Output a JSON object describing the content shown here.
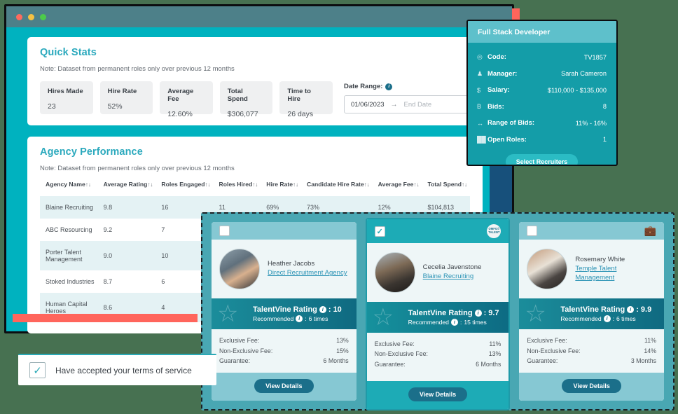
{
  "window": {
    "traffic_lights": [
      "close",
      "minimize",
      "maximize"
    ]
  },
  "quick_stats": {
    "title": "Quick Stats",
    "note": "Note: Dataset from permanent roles only over previous 12 months",
    "cards": [
      {
        "label": "Hires Made",
        "value": "23"
      },
      {
        "label": "Hire Rate",
        "value": "52%"
      },
      {
        "label": "Average Fee",
        "value": "12.60%"
      },
      {
        "label": "Total Spend",
        "value": "$306,077"
      },
      {
        "label": "Time to Hire",
        "value": "26 days"
      }
    ],
    "date_range": {
      "label": "Date Range:",
      "info_icon": "info-icon",
      "start": "01/06/2023",
      "arrow": "→",
      "end_placeholder": "End Date"
    }
  },
  "agency_performance": {
    "title": "Agency Performance",
    "note": "Note: Dataset from permanent roles only over previous 12 months",
    "columns": [
      "Agency Name",
      "Average Rating",
      "Roles Engaged",
      "Roles Hired",
      "Hire Rate",
      "Candidate Hire Rate",
      "Average Fee",
      "Total Spend"
    ],
    "sort_glyph": "↑↓",
    "rows": [
      {
        "agency": "Blaine Recruiting",
        "rating": "9.8",
        "engaged": "16",
        "hired": "11",
        "hire_rate": "69%",
        "candidate_hire_rate": "73%",
        "average_fee": "12%",
        "total_spend": "$104,813"
      },
      {
        "agency": "ABC Resourcing",
        "rating": "9.2",
        "engaged": "7",
        "hired": "",
        "hire_rate": "",
        "candidate_hire_rate": "",
        "average_fee": "",
        "total_spend": ""
      },
      {
        "agency": "Porter Talent Management",
        "rating": "9.0",
        "engaged": "10",
        "hired": "",
        "hire_rate": "",
        "candidate_hire_rate": "",
        "average_fee": "",
        "total_spend": ""
      },
      {
        "agency": "Stoked Industries",
        "rating": "8.7",
        "engaged": "6",
        "hired": "",
        "hire_rate": "",
        "candidate_hire_rate": "",
        "average_fee": "",
        "total_spend": ""
      },
      {
        "agency": "Human Capital Heroes",
        "rating": "8.6",
        "engaged": "4",
        "hired": "",
        "hire_rate": "",
        "candidate_hire_rate": "",
        "average_fee": "",
        "total_spend": ""
      }
    ]
  },
  "job_card": {
    "title": "Full Stack Developer",
    "rows": [
      {
        "icon": "target-icon",
        "glyph": "◎",
        "key": "Code:",
        "value": "TV1857"
      },
      {
        "icon": "person-icon",
        "glyph": "♟",
        "key": "Manager:",
        "value": "Sarah Cameron"
      },
      {
        "icon": "dollar-icon",
        "glyph": "$",
        "key": "Salary:",
        "value": "$110,000 - $135,000"
      },
      {
        "icon": "bid-icon",
        "glyph": "B",
        "key": "Bids:",
        "value": "8"
      },
      {
        "icon": "range-icon",
        "glyph": "↔",
        "key": "Range of Bids:",
        "value": "11% - 16%"
      },
      {
        "icon": "roles-icon",
        "glyph": "██",
        "key": "Open Roles:",
        "value": "1"
      }
    ],
    "button_label": "Select Recruiters"
  },
  "recruiters": {
    "fee_labels": {
      "exclusive": "Exclusive Fee:",
      "non_exclusive": "Non-Exclusive Fee:",
      "guarantee": "Guarantee:"
    },
    "rating_label": "TalentVine Rating",
    "recommended_label": "Recommended",
    "view_details_label": "View Details",
    "cards": [
      {
        "selected": false,
        "checkbox_glyph": "",
        "header_icon": "none",
        "avatar": "recruiter-avatar",
        "name": "Heather Jacobs",
        "agency": "Direct Recruitment Agency",
        "rating": "10",
        "recommended": "6 times",
        "exclusive_fee": "13%",
        "non_exclusive_fee": "15%",
        "guarantee": "6 Months"
      },
      {
        "selected": true,
        "checkbox_glyph": "✓",
        "header_icon": "award-badge-icon",
        "badge_text": "OMFG© TALENT",
        "avatar": "recruiter-avatar",
        "name": "Cecelia Javenstone",
        "agency": "Blaine Recruiting",
        "rating": "9.7",
        "recommended": "15 times",
        "exclusive_fee": "11%",
        "non_exclusive_fee": "13%",
        "guarantee": "6 Months"
      },
      {
        "selected": false,
        "checkbox_glyph": "",
        "header_icon": "briefcase-icon",
        "avatar": "recruiter-avatar",
        "name": "Rosemary White",
        "agency": "Temple Talent Management",
        "rating": "9.9",
        "recommended": "6 times",
        "exclusive_fee": "11%",
        "non_exclusive_fee": "14%",
        "guarantee": "3 Months"
      }
    ]
  },
  "terms_toast": {
    "checked_glyph": "✓",
    "text": "Have accepted your terms of service"
  },
  "colors": {
    "page_background": "#477151",
    "accent_teal": "#2ba9bd",
    "sidebar_cyan": "#00b2bf",
    "navy": "#17507b",
    "coral": "#ff655c",
    "link": "#2b93b5"
  }
}
